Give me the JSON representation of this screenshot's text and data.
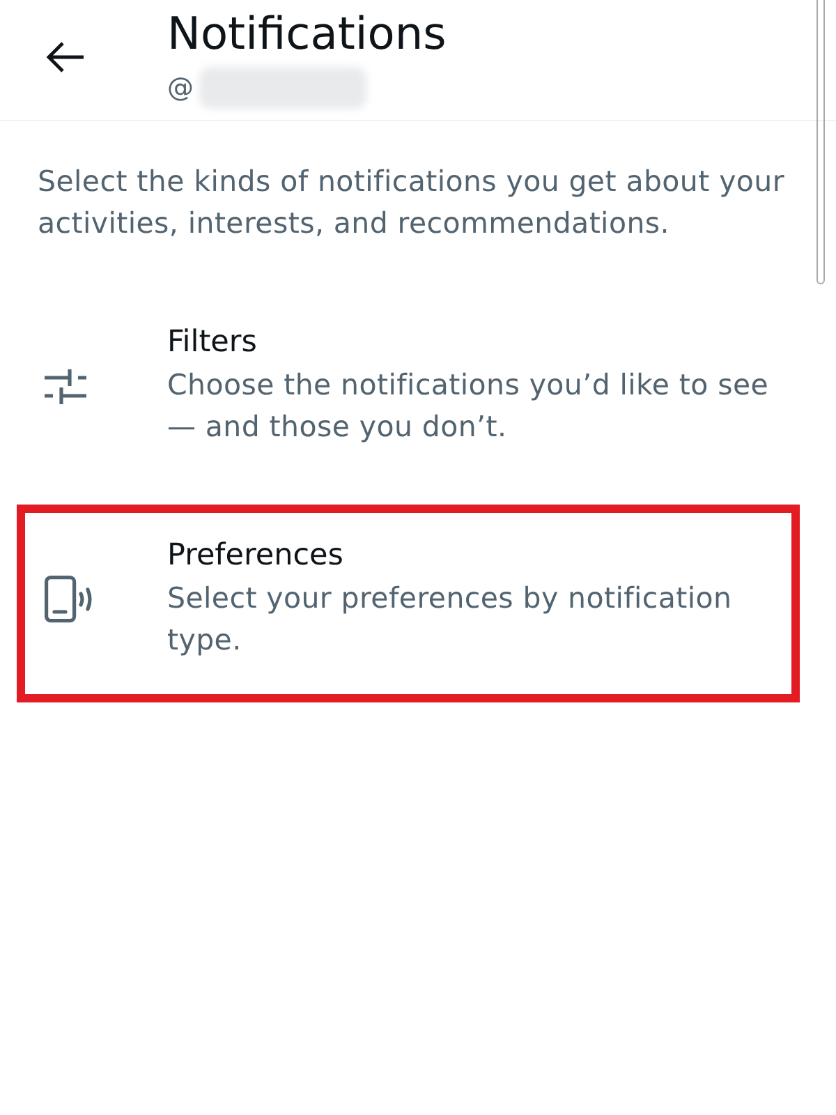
{
  "header": {
    "title": "Notifications",
    "handle_prefix": "@",
    "handle_redacted": true
  },
  "description": "Select the kinds of notifications you get about your activities, interests, and recommendations.",
  "items": [
    {
      "kind": "filters",
      "title": "Filters",
      "subtitle": "Choose the notifications you’d like to see — and those you don’t.",
      "highlighted": false
    },
    {
      "kind": "preferences",
      "title": "Preferences",
      "subtitle": "Select your preferences by notification type.",
      "highlighted": true
    }
  ]
}
